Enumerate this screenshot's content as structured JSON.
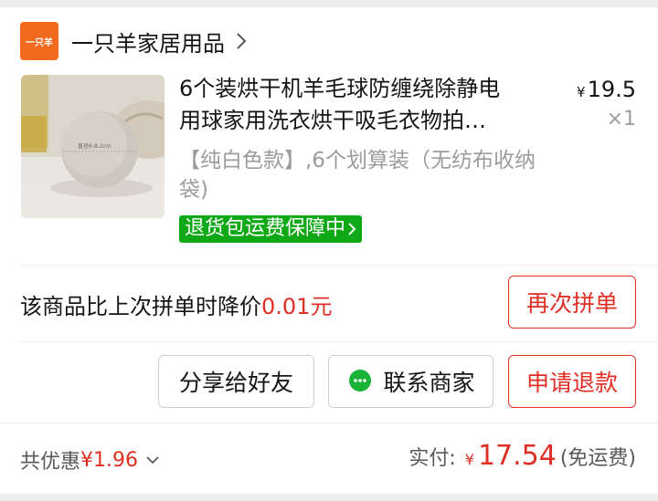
{
  "store": {
    "logo_text": "一只羊",
    "name": "一只羊家居用品"
  },
  "product": {
    "title_line1": "6个装烘干机羊毛球防缠绕除静电",
    "title_line2": "用球家用洗衣烘干吸毛衣物拍…",
    "price_currency": "¥",
    "price": "19.5",
    "qty": "×1",
    "spec": "【纯白色款】,6个划算装（无纺布收纳袋)",
    "badge": "退货包运费保障中",
    "ball_label": "直径6-8.2cm"
  },
  "drop_notice": {
    "text": "该商品比上次拼单时降价",
    "amount": "0.01元"
  },
  "buttons": {
    "reorder": "再次拼单",
    "share": "分享给好友",
    "contact": "联系商家",
    "refund": "申请退款"
  },
  "footer": {
    "saving_label": "共优惠",
    "saving_amount": "¥1.96",
    "paid_label": "实付:",
    "paid_currency": "¥",
    "paid_amount": "17.54",
    "shipping": "(免运费)"
  },
  "colors": {
    "accent_red": "#e02e24",
    "badge_green": "#0fa816",
    "logo_orange": "#f26b1d"
  }
}
